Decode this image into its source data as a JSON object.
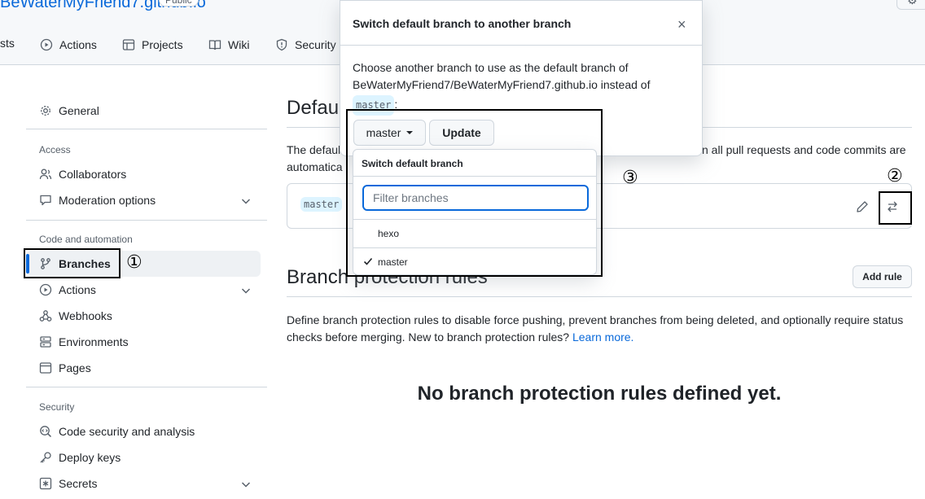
{
  "repo": {
    "title": "BeWaterMyFriend7.github.io",
    "visibility": "Public"
  },
  "header": {
    "corner_symbol": "⚙"
  },
  "tabs": [
    {
      "label": "sts",
      "icon": "none"
    },
    {
      "label": "Actions",
      "icon": "play-icon"
    },
    {
      "label": "Projects",
      "icon": "table-icon"
    },
    {
      "label": "Wiki",
      "icon": "book-icon"
    },
    {
      "label": "Security",
      "icon": "shield-icon"
    }
  ],
  "sidebar": {
    "general": "General",
    "access_heading": "Access",
    "collaborators": "Collaborators",
    "moderation": "Moderation options",
    "code_heading": "Code and automation",
    "branches": "Branches",
    "actions": "Actions",
    "webhooks": "Webhooks",
    "environments": "Environments",
    "pages": "Pages",
    "security_heading": "Security",
    "code_security": "Code security and analysis",
    "deploy_keys": "Deploy keys",
    "secrets": "Secrets"
  },
  "main": {
    "default_heading": "Defau",
    "default_desc_left_1": "The defaul",
    "default_desc_left_2": "automatica",
    "default_desc_right": "n all pull requests and code commits are",
    "current_branch": "master",
    "protection_heading": "Branch protection rules",
    "add_rule": "Add rule",
    "protection_desc_1": "Define branch protection rules to disable force pushing, prevent branches from being deleted, and optionally require status",
    "protection_desc_2": "checks before merging. New to branch protection rules?",
    "learn_more": "Learn more.",
    "empty_state": "No branch protection rules defined yet."
  },
  "modal": {
    "title": "Switch default branch to another branch",
    "close": "×",
    "body_line1": "Choose another branch to use as the default branch of",
    "body_line2": "BeWaterMyFriend7/BeWaterMyFriend7.github.io instead of",
    "body_branch": "master",
    "body_suffix": ":",
    "select_label": "master",
    "update_label": "Update"
  },
  "dropdown": {
    "title": "Switch default branch",
    "filter_placeholder": "Filter branches",
    "items": [
      {
        "label": "hexo",
        "selected": false
      },
      {
        "label": "master",
        "selected": true
      }
    ]
  },
  "annotations": {
    "one": "①",
    "two": "②",
    "three": "③"
  },
  "colors": {
    "accent": "#0969da",
    "border": "#d0d7de",
    "muted": "#57606a",
    "chip_bg": "#ddf4ff"
  }
}
